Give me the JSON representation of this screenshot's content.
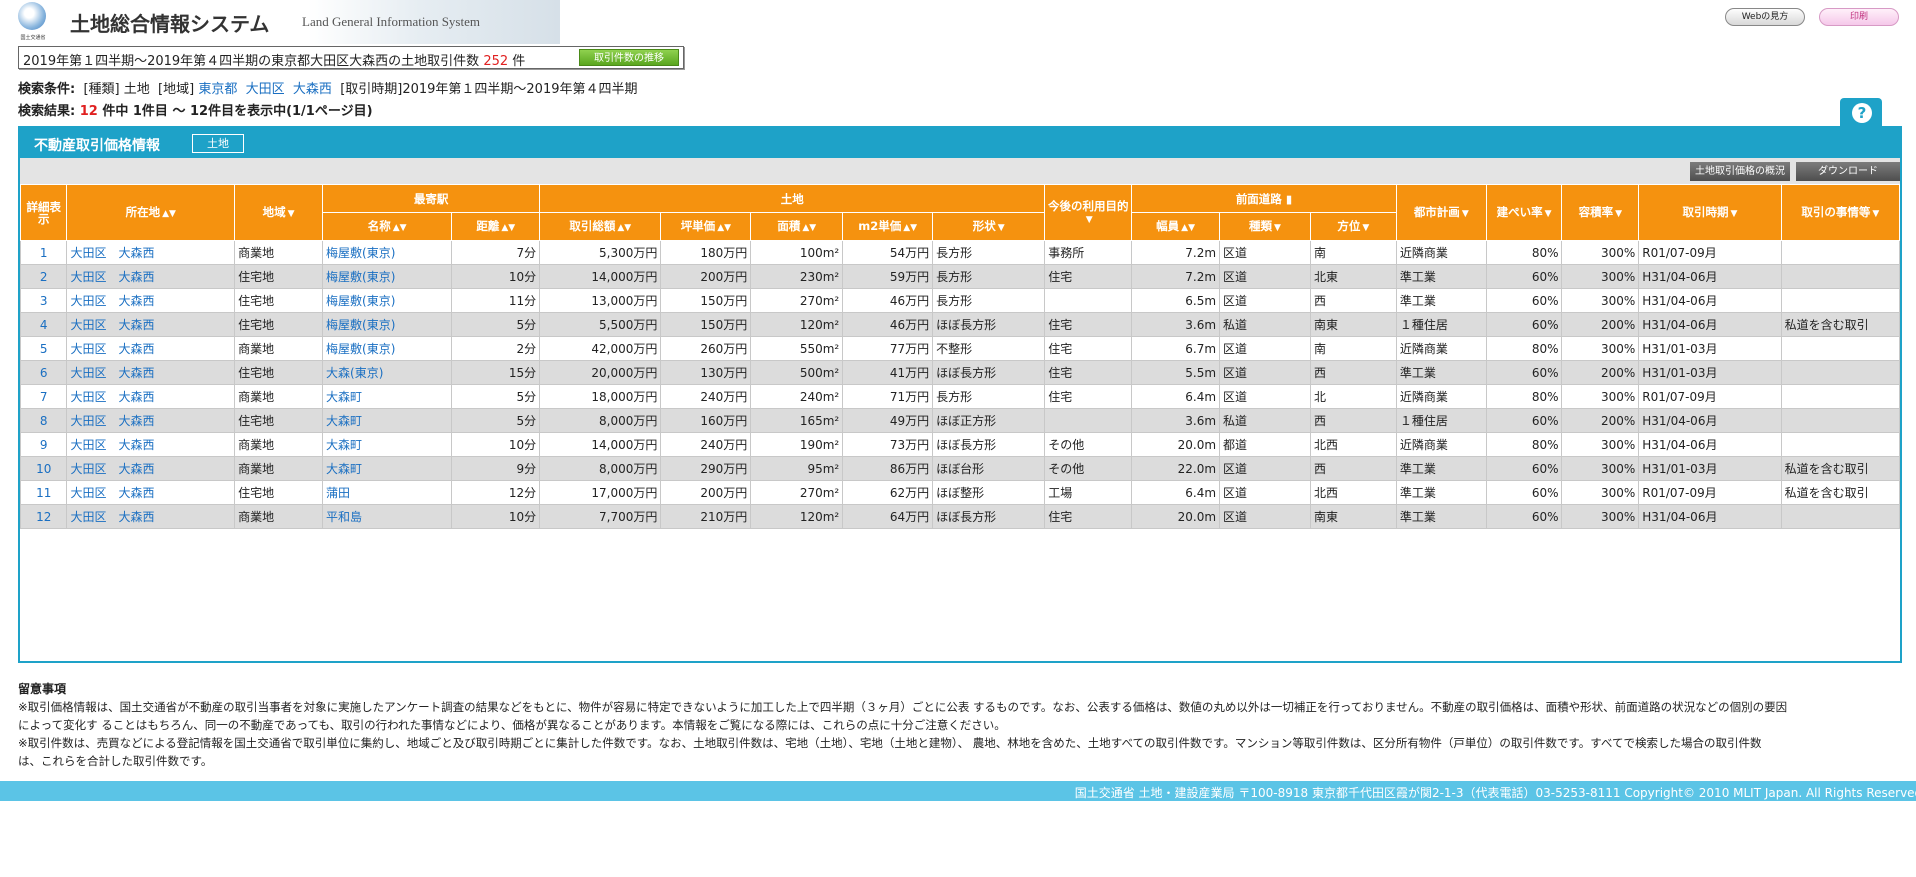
{
  "header": {
    "logo_caption": "国土交通省",
    "system_title": "土地総合情報システム",
    "system_subtitle": "Land General Information System",
    "web_guide_label": "Webの見方",
    "print_label": "印刷"
  },
  "summary": {
    "prefix": "2019年第１四半期〜2019年第４四半期の東京都大田区大森西の土地取引件数",
    "count": "252",
    "suffix": "件",
    "trend_button": "取引件数の推移"
  },
  "conditions": {
    "label": "検索条件:",
    "type_label": "[種類]",
    "type_value": "土地",
    "region_label": "[地域]",
    "pref": "東京都",
    "city": "大田区",
    "district": "大森西",
    "period": "[取引時期]2019年第１四半期〜2019年第４四半期"
  },
  "result": {
    "label": "検索結果:",
    "total": "12",
    "text": "件中 1件目 〜 12件目を表示中(1/1ページ目)"
  },
  "help_icon": "?",
  "panel": {
    "title": "不動産取引価格情報",
    "badge": "土地",
    "overview_button": "土地取引価格の概況",
    "download_button": "ダウンロード"
  },
  "table": {
    "headers": {
      "detail": "詳細表示",
      "location": "所在地",
      "area_type": "地域",
      "station_group": "最寄駅",
      "station_name": "名称",
      "station_dist": "距離",
      "land_group": "土地",
      "total_price": "取引総額",
      "tsubo_price": "坪単価",
      "area": "面積",
      "m2_price": "m2単価",
      "shape": "形状",
      "future_use": "今後の利用目的",
      "road_group": "前面道路",
      "road_width": "幅員",
      "road_type": "種類",
      "road_dir": "方位",
      "city_plan": "都市計画",
      "coverage": "建ぺい率",
      "far": "容積率",
      "period": "取引時期",
      "circumstances": "取引の事情等"
    },
    "rows": [
      {
        "no": "1",
        "loc1": "大田区",
        "loc2": "大森西",
        "type": "商業地",
        "station": "梅屋敷(東京)",
        "dist": "7分",
        "total": "5,300万円",
        "tsubo": "180万円",
        "area": "100m²",
        "m2": "54万円",
        "shape": "長方形",
        "use": "事務所",
        "width": "7.2m",
        "rtype": "区道",
        "dir": "南",
        "plan": "近隣商業",
        "bcr": "80%",
        "far": "300%",
        "period": "R01/07-09月",
        "note": ""
      },
      {
        "no": "2",
        "loc1": "大田区",
        "loc2": "大森西",
        "type": "住宅地",
        "station": "梅屋敷(東京)",
        "dist": "10分",
        "total": "14,000万円",
        "tsubo": "200万円",
        "area": "230m²",
        "m2": "59万円",
        "shape": "長方形",
        "use": "住宅",
        "width": "7.2m",
        "rtype": "区道",
        "dir": "北東",
        "plan": "準工業",
        "bcr": "60%",
        "far": "300%",
        "period": "H31/04-06月",
        "note": ""
      },
      {
        "no": "3",
        "loc1": "大田区",
        "loc2": "大森西",
        "type": "住宅地",
        "station": "梅屋敷(東京)",
        "dist": "11分",
        "total": "13,000万円",
        "tsubo": "150万円",
        "area": "270m²",
        "m2": "46万円",
        "shape": "長方形",
        "use": "",
        "width": "6.5m",
        "rtype": "区道",
        "dir": "西",
        "plan": "準工業",
        "bcr": "60%",
        "far": "300%",
        "period": "H31/04-06月",
        "note": ""
      },
      {
        "no": "4",
        "loc1": "大田区",
        "loc2": "大森西",
        "type": "住宅地",
        "station": "梅屋敷(東京)",
        "dist": "5分",
        "total": "5,500万円",
        "tsubo": "150万円",
        "area": "120m²",
        "m2": "46万円",
        "shape": "ほぼ長方形",
        "use": "住宅",
        "width": "3.6m",
        "rtype": "私道",
        "dir": "南東",
        "plan": "１種住居",
        "bcr": "60%",
        "far": "200%",
        "period": "H31/04-06月",
        "note": "私道を含む取引"
      },
      {
        "no": "5",
        "loc1": "大田区",
        "loc2": "大森西",
        "type": "商業地",
        "station": "梅屋敷(東京)",
        "dist": "2分",
        "total": "42,000万円",
        "tsubo": "260万円",
        "area": "550m²",
        "m2": "77万円",
        "shape": "不整形",
        "use": "住宅",
        "width": "6.7m",
        "rtype": "区道",
        "dir": "南",
        "plan": "近隣商業",
        "bcr": "80%",
        "far": "300%",
        "period": "H31/01-03月",
        "note": ""
      },
      {
        "no": "6",
        "loc1": "大田区",
        "loc2": "大森西",
        "type": "住宅地",
        "station": "大森(東京)",
        "dist": "15分",
        "total": "20,000万円",
        "tsubo": "130万円",
        "area": "500m²",
        "m2": "41万円",
        "shape": "ほぼ長方形",
        "use": "住宅",
        "width": "5.5m",
        "rtype": "区道",
        "dir": "西",
        "plan": "準工業",
        "bcr": "60%",
        "far": "200%",
        "period": "H31/01-03月",
        "note": ""
      },
      {
        "no": "7",
        "loc1": "大田区",
        "loc2": "大森西",
        "type": "商業地",
        "station": "大森町",
        "dist": "5分",
        "total": "18,000万円",
        "tsubo": "240万円",
        "area": "240m²",
        "m2": "71万円",
        "shape": "長方形",
        "use": "住宅",
        "width": "6.4m",
        "rtype": "区道",
        "dir": "北",
        "plan": "近隣商業",
        "bcr": "80%",
        "far": "300%",
        "period": "R01/07-09月",
        "note": ""
      },
      {
        "no": "8",
        "loc1": "大田区",
        "loc2": "大森西",
        "type": "住宅地",
        "station": "大森町",
        "dist": "5分",
        "total": "8,000万円",
        "tsubo": "160万円",
        "area": "165m²",
        "m2": "49万円",
        "shape": "ほぼ正方形",
        "use": "",
        "width": "3.6m",
        "rtype": "私道",
        "dir": "西",
        "plan": "１種住居",
        "bcr": "60%",
        "far": "200%",
        "period": "H31/04-06月",
        "note": ""
      },
      {
        "no": "9",
        "loc1": "大田区",
        "loc2": "大森西",
        "type": "商業地",
        "station": "大森町",
        "dist": "10分",
        "total": "14,000万円",
        "tsubo": "240万円",
        "area": "190m²",
        "m2": "73万円",
        "shape": "ほぼ長方形",
        "use": "その他",
        "width": "20.0m",
        "rtype": "都道",
        "dir": "北西",
        "plan": "近隣商業",
        "bcr": "80%",
        "far": "300%",
        "period": "H31/04-06月",
        "note": ""
      },
      {
        "no": "10",
        "loc1": "大田区",
        "loc2": "大森西",
        "type": "商業地",
        "station": "大森町",
        "dist": "9分",
        "total": "8,000万円",
        "tsubo": "290万円",
        "area": "95m²",
        "m2": "86万円",
        "shape": "ほぼ台形",
        "use": "その他",
        "width": "22.0m",
        "rtype": "区道",
        "dir": "西",
        "plan": "準工業",
        "bcr": "60%",
        "far": "300%",
        "period": "H31/01-03月",
        "note": "私道を含む取引"
      },
      {
        "no": "11",
        "loc1": "大田区",
        "loc2": "大森西",
        "type": "住宅地",
        "station": "蒲田",
        "dist": "12分",
        "total": "17,000万円",
        "tsubo": "200万円",
        "area": "270m²",
        "m2": "62万円",
        "shape": "ほぼ整形",
        "use": "工場",
        "width": "6.4m",
        "rtype": "区道",
        "dir": "北西",
        "plan": "準工業",
        "bcr": "60%",
        "far": "300%",
        "period": "R01/07-09月",
        "note": "私道を含む取引"
      },
      {
        "no": "12",
        "loc1": "大田区",
        "loc2": "大森西",
        "type": "商業地",
        "station": "平和島",
        "dist": "10分",
        "total": "7,700万円",
        "tsubo": "210万円",
        "area": "120m²",
        "m2": "64万円",
        "shape": "ほぼ長方形",
        "use": "住宅",
        "width": "20.0m",
        "rtype": "区道",
        "dir": "南東",
        "plan": "準工業",
        "bcr": "60%",
        "far": "300%",
        "period": "H31/04-06月",
        "note": ""
      }
    ]
  },
  "notes": {
    "title": "留意事項",
    "line1": "※取引価格情報は、国土交通省が不動産の取引当事者を対象に実施したアンケート調査の結果などをもとに、物件が容易に特定できないように加工した上で四半期（３ヶ月）ごとに公表 するものです。なお、公表する価格は、数値の丸め以外は一切補正を行っておりません。不動産の取引価格は、面積や形状、前面道路の状況などの個別の要因",
    "line2": "によって変化す ることはもちろん、同一の不動産であっても、取引の行われた事情などにより、価格が異なることがあります。本情報をご覧になる際には、これらの点に十分ご注意ください。",
    "line3": "※取引件数は、売買などによる登記情報を国土交通省で取引単位に集約し、地域ごと及び取引時期ごとに集計した件数です。なお、土地取引件数は、宅地（土地）、宅地（土地と建物）、 農地、林地を含めた、土地すべての取引件数です。マンション等取引件数は、区分所有物件（戸単位）の取引件数です。すべてで検索した場合の取引件数",
    "line4": "は、これらを合計した取引件数です。"
  },
  "footer": {
    "text": "国土交通省 土地・建設産業局 〒100-8918 東京都千代田区霞が関2-1-3（代表電話）03-5253-8111 Copyright© 2010 MLIT Japan. All Rights Reserved."
  }
}
